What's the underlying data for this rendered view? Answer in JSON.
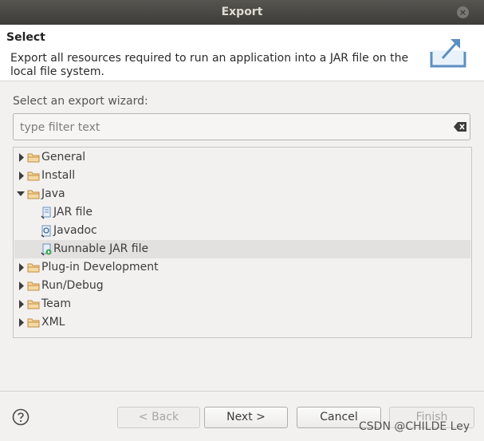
{
  "window": {
    "title": "Export",
    "close_glyph": "×"
  },
  "header": {
    "title": "Select",
    "description": "Export all resources required to run an application into a JAR file on the local file system.",
    "icon": "export-wizard-icon"
  },
  "wizard_label": "Select an export wizard:",
  "filter": {
    "placeholder": "type filter text",
    "value": "",
    "clear_icon": "clear-filter-icon"
  },
  "tree": {
    "items": [
      {
        "label": "General",
        "icon": "folder-icon",
        "expanded": false
      },
      {
        "label": "Install",
        "icon": "folder-icon",
        "expanded": false
      },
      {
        "label": "Java",
        "icon": "folder-icon",
        "expanded": true
      },
      {
        "label": "JAR file",
        "icon": "jar-file-icon"
      },
      {
        "label": "Javadoc",
        "icon": "javadoc-icon"
      },
      {
        "label": "Runnable JAR file",
        "icon": "runnable-jar-icon",
        "selected": true
      },
      {
        "label": "Plug-in Development",
        "icon": "folder-icon",
        "expanded": false
      },
      {
        "label": "Run/Debug",
        "icon": "folder-icon",
        "expanded": false
      },
      {
        "label": "Team",
        "icon": "folder-icon",
        "expanded": false
      },
      {
        "label": "XML",
        "icon": "folder-icon",
        "expanded": false
      }
    ]
  },
  "buttons": {
    "help_icon": "help-icon",
    "back": "< Back",
    "next": "Next >",
    "cancel": "Cancel",
    "finish": "Finish"
  },
  "watermark": "CSDN @CHILDE Ley",
  "colors": {
    "titlebar": "#45443f",
    "header_bg": "#ffffff",
    "dialog_bg": "#f2f1f0",
    "selection": "#e2e1df",
    "folder": "#c68a3c"
  }
}
